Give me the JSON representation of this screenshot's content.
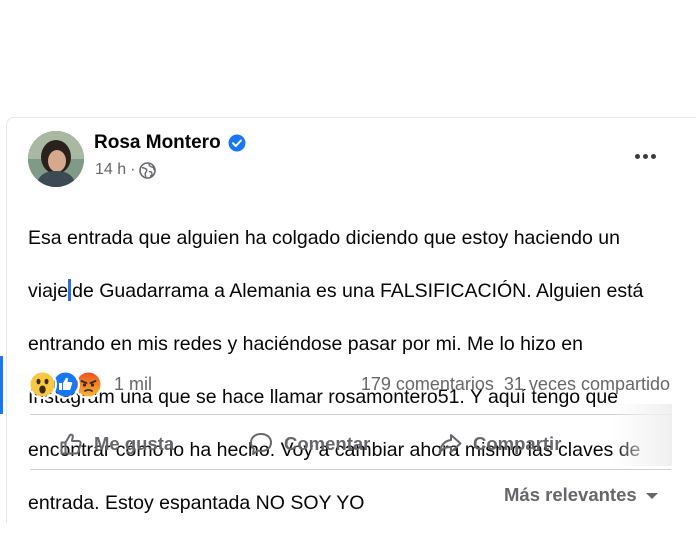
{
  "post": {
    "author": "Rosa Montero",
    "time": "14 h",
    "privacy_icon": "globe-icon",
    "verified_icon": "verified-badge-icon",
    "text_lines": [
      "Esa entrada que alguien ha colgado diciendo  que estoy haciendo un",
      "de Guadarrama a Alemania es una FALSIFICACIÓN. Alguien está",
      "entrando en mis redes y haciéndose pasar por mi. Me lo hizo en",
      "Instagram una que se hace llamar rosamontero51. Y aquí tengo que",
      "encontrar cómo lo ha hecho. Voy a cambiar ahora mismo las claves de",
      "entrada. Estoy espantada NO SOY YO"
    ],
    "line2_prefix": "viaje",
    "reactions": [
      "wow",
      "like",
      "angry"
    ],
    "reaction_count": "1 mil",
    "comments": "179 comentarios",
    "shares": "31 veces compartido",
    "accent_color": "#1877f2"
  },
  "actions": {
    "like": "Me gusta",
    "comment": "Comentar",
    "share": "Compartir"
  },
  "comments_sort": {
    "label": "Más relevantes",
    "icon": "caret-down-icon"
  }
}
